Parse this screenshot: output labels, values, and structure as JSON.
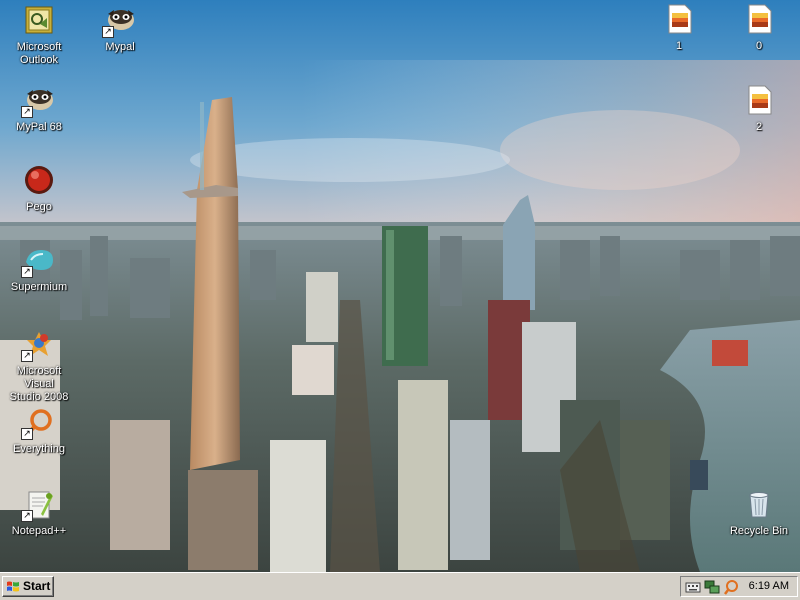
{
  "desktop": {
    "icons": [
      {
        "label": "Microsoft\nOutlook",
        "icon": "outlook-icon"
      },
      {
        "label": "Mypal",
        "icon": "mypal-icon"
      },
      {
        "label": "MyPal 68",
        "icon": "mypal-icon"
      },
      {
        "label": "Pego",
        "icon": "pego-icon"
      },
      {
        "label": "Supermium",
        "icon": "supermium-icon"
      },
      {
        "label": "Microsoft Visual\nStudio 2008",
        "icon": "visual-studio-icon"
      },
      {
        "label": "Everything",
        "icon": "everything-icon"
      },
      {
        "label": "Notepad++",
        "icon": "notepad-plus-plus-icon"
      },
      {
        "label": "1",
        "icon": "image-file-icon"
      },
      {
        "label": "0",
        "icon": "image-file-icon"
      },
      {
        "label": "2",
        "icon": "image-file-icon"
      },
      {
        "label": "Recycle Bin",
        "icon": "recycle-bin-icon"
      }
    ]
  },
  "taskbar": {
    "start_label": "Start",
    "clock": "6:19 AM"
  },
  "colors": {
    "taskbar": "#d4d0c8",
    "sky_top": "#2f84c0",
    "sky_horizon": "#d8c8c0",
    "river": "#6a8a8a"
  }
}
